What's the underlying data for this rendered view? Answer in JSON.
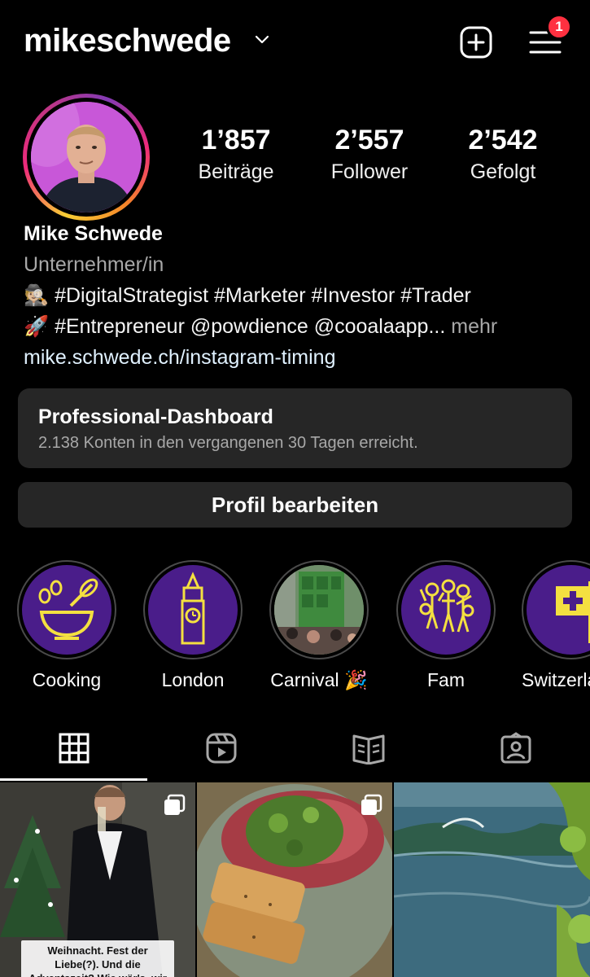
{
  "header": {
    "username": "mikeschwede",
    "notification_count": "1",
    "icons": [
      "chevron-down-icon",
      "new-post-icon",
      "menu-icon"
    ]
  },
  "profile": {
    "stats": [
      {
        "value": "1’857",
        "label": "Beiträge"
      },
      {
        "value": "2’557",
        "label": "Follower"
      },
      {
        "value": "2’542",
        "label": "Gefolgt"
      }
    ],
    "name": "Mike Schwede",
    "category": "Unternehmer/in",
    "bio_line1": "🕵🏼 #DigitalStrategist #Marketer #Investor #Trader",
    "bio_line2": "🚀 #Entrepreneur @powdience @cooalaapp...",
    "bio_more": "mehr",
    "link": "mike.schwede.ch/instagram-timing"
  },
  "dashboard": {
    "title": "Professional-Dashboard",
    "subtitle": "2.138 Konten in den vergangenen 30 Tagen erreicht."
  },
  "edit_profile_label": "Profil bearbeiten",
  "highlights": [
    {
      "label": "Cooking",
      "icon": "cooking-bowl-icon"
    },
    {
      "label": "London",
      "icon": "big-ben-icon"
    },
    {
      "label": "Carnival 🎉",
      "icon": "carnival-photo"
    },
    {
      "label": "Fam",
      "icon": "family-icon"
    },
    {
      "label": "Switzerla",
      "icon": "swiss-flag-icon"
    }
  ],
  "tabs": [
    {
      "name": "grid",
      "icon": "grid-icon",
      "active": true
    },
    {
      "name": "reels",
      "icon": "reels-icon",
      "active": false
    },
    {
      "name": "guides",
      "icon": "guide-icon",
      "active": false
    },
    {
      "name": "tagged",
      "icon": "tagged-icon",
      "active": false
    }
  ],
  "posts": [
    {
      "caption": "Weihnacht. Fest der Liebe(?). Und die Adventszeit? Wie wär's, wir feiern einen Monat die Selbstliebe",
      "multi": true
    },
    {
      "caption": "",
      "multi": true
    },
    {
      "caption": "",
      "multi": false
    }
  ],
  "colors": {
    "background": "#000000",
    "surface": "#262626",
    "badge": "#ff3040",
    "highlight_fill": "#4a1d8a",
    "highlight_art": "#f4e040"
  }
}
